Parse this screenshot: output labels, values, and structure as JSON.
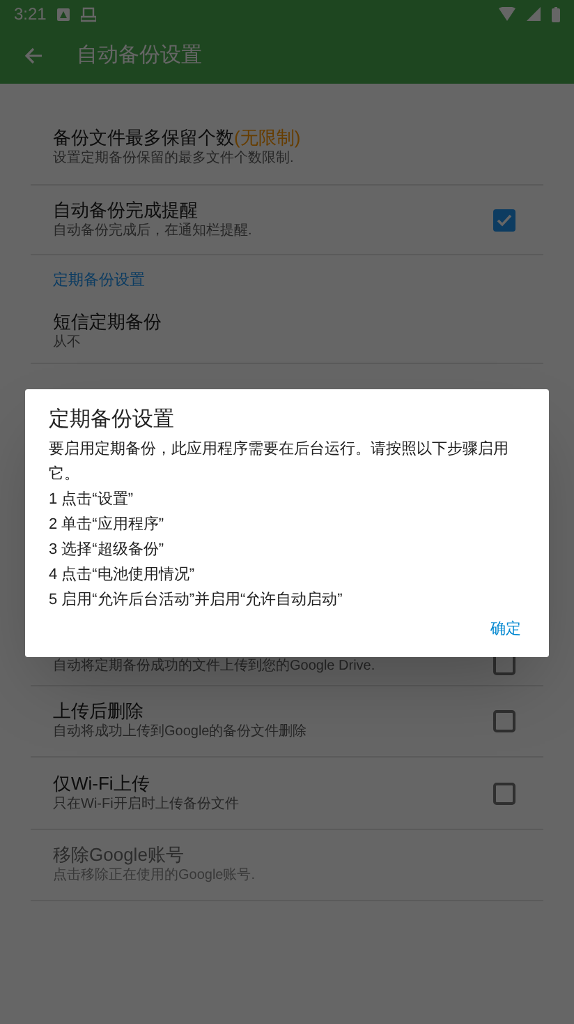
{
  "status_bar": {
    "time": "3:21"
  },
  "app_bar": {
    "title": "自动备份设置"
  },
  "settings": [
    {
      "kind": "item",
      "title": "备份文件最多保留个数",
      "note": "(无限制)",
      "subtitle": "设置定期备份保留的最多文件个数限制.",
      "disabled": false
    },
    {
      "kind": "item",
      "title": "自动备份完成提醒",
      "subtitle": "自动备份完成后，在通知栏提醒.",
      "checked": true,
      "disabled": false
    },
    {
      "kind": "header",
      "title": "定期备份设置"
    },
    {
      "kind": "item",
      "title": "短信定期备份",
      "subtitle": "从不",
      "disabled": false
    },
    {
      "kind": "gap"
    },
    {
      "kind": "gap"
    },
    {
      "kind": "item",
      "subtitle": "自动将定期备份成功的文件上传到您的Google Drive.",
      "checked": false,
      "disabled": false
    },
    {
      "kind": "item",
      "title": "上传后删除",
      "subtitle": "自动将成功上传到Google的备份文件删除",
      "checked": false,
      "disabled": false
    },
    {
      "kind": "item",
      "title": "仅Wi-Fi上传",
      "subtitle": "只在Wi-Fi开启时上传备份文件",
      "checked": false,
      "disabled": false
    },
    {
      "kind": "item",
      "title": "移除Google账号",
      "subtitle": "点击移除正在使用的Google账号.",
      "disabled": true
    }
  ],
  "dialog": {
    "title": "定期备份设置",
    "message": "要启用定期备份，此应用程序需要在后台运行。请按照以下步骤启用它。",
    "steps": [
      "1 点击“设置”",
      "2 单击“应用程序”",
      "3 选择“超级备份”",
      "4 点击“电池使用情况”",
      "5 启用“允许后台活动”并启用“允许自动启动”"
    ],
    "button": "确定"
  }
}
